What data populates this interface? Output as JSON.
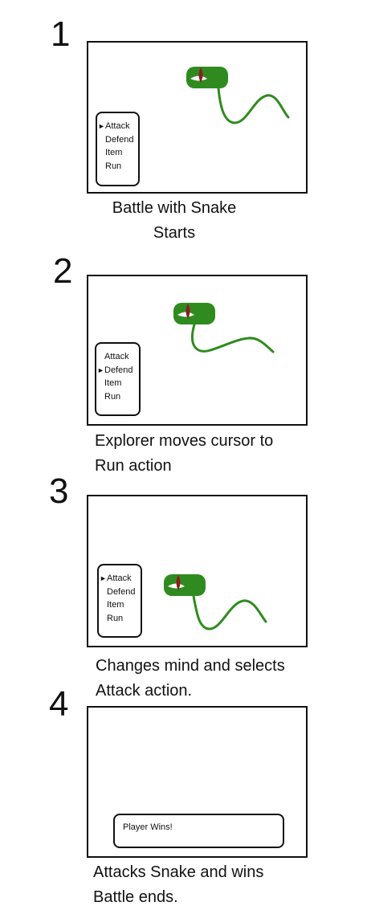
{
  "colors": {
    "snake_body": "#2f8b1f",
    "snake_head": "#2f8b1f",
    "snake_eye": "#8b1e1e",
    "outline": "#111111"
  },
  "steps": [
    {
      "number": "1",
      "menu": [
        "Attack",
        "Defend",
        "Item",
        "Run"
      ],
      "cursor_index": 0,
      "cursor_symbol": "►",
      "caption_lines": [
        "Battle with Snake",
        "Starts"
      ]
    },
    {
      "number": "2",
      "menu": [
        "Attack",
        "Defend",
        "Item",
        "Run"
      ],
      "cursor_index": 1,
      "cursor_symbol": "►",
      "caption_lines": [
        "Explorer moves cursor to",
        "Run action"
      ]
    },
    {
      "number": "3",
      "menu": [
        "Attack",
        "Defend",
        "Item",
        "Run"
      ],
      "cursor_index": 0,
      "cursor_symbol": "►",
      "caption_lines": [
        "Changes mind and selects",
        "Attack action."
      ]
    },
    {
      "number": "4",
      "message": "Player Wins!",
      "caption_lines": [
        "Attacks Snake and wins",
        "Battle ends."
      ]
    }
  ]
}
